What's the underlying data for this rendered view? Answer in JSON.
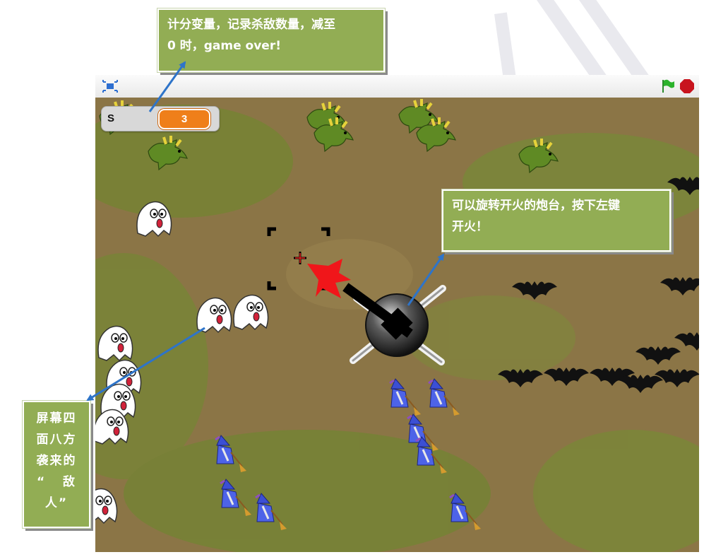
{
  "stage_toolbar": {
    "fullscreen_icon": "presentation-mode-icon",
    "flag_icon": "green-flag-icon",
    "stop_icon": "stop-sign-icon",
    "flag_color": "#2cb32c",
    "stop_color": "#c8141e"
  },
  "score_monitor": {
    "label": "S",
    "value": "3",
    "value_color": "#ef7f1a"
  },
  "callouts": {
    "score": {
      "line1": "计分变量，记录杀敌数量，减至",
      "line2": "0 时，game over!"
    },
    "turret": {
      "line1": "可以旋转开火的炮台，按下左键",
      "line2": "开火！"
    },
    "enemies": {
      "line1": "屏幕四",
      "line2": "面八方",
      "line3": "袭来的",
      "line4": "“   敌",
      "line5": "人”"
    },
    "fill_color": "#92ad54"
  },
  "arrow_color": "#2e74c9",
  "sprites": {
    "dragon_count": 7,
    "ghost_count": 8,
    "bat_count": 10,
    "witch_count": 8,
    "crosshair": "crosshair-icon",
    "turret": "cannon-turret"
  }
}
